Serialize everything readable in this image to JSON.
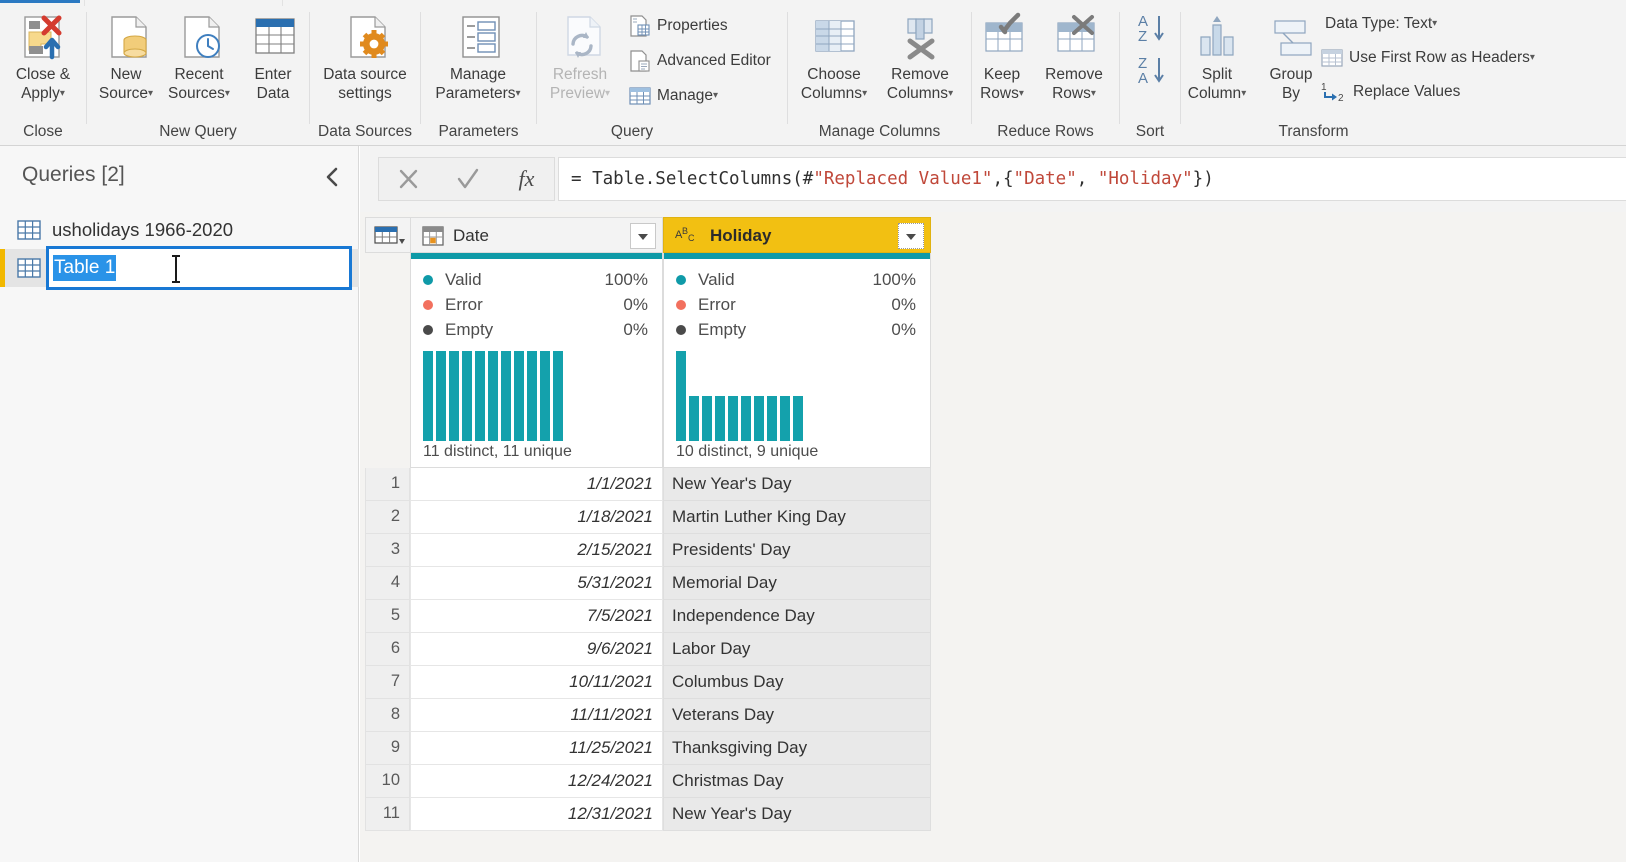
{
  "ribbon": {
    "groups": [
      {
        "name": "Close",
        "label": "Close",
        "buttons": [
          {
            "name": "close-and-apply",
            "line1": "Close &",
            "line2": "Apply",
            "dropdown": true,
            "disabled": false
          }
        ]
      },
      {
        "name": "New Query",
        "label": "New Query",
        "buttons": [
          {
            "name": "new-source",
            "line1": "New",
            "line2": "Source",
            "dropdown": true,
            "disabled": false
          },
          {
            "name": "recent-sources",
            "line1": "Recent",
            "line2": "Sources",
            "dropdown": true,
            "disabled": false
          },
          {
            "name": "enter-data",
            "line1": "Enter",
            "line2": "Data",
            "dropdown": false,
            "disabled": false
          }
        ]
      },
      {
        "name": "Data Sources",
        "label": "Data Sources",
        "buttons": [
          {
            "name": "data-source-settings",
            "line1": "Data source",
            "line2": "settings",
            "dropdown": false,
            "disabled": false
          }
        ]
      },
      {
        "name": "Parameters",
        "label": "Parameters",
        "buttons": [
          {
            "name": "manage-parameters",
            "line1": "Manage",
            "line2": "Parameters",
            "dropdown": true,
            "disabled": false
          }
        ]
      },
      {
        "name": "Query",
        "label": "Query",
        "buttons": [
          {
            "name": "refresh-preview",
            "line1": "Refresh",
            "line2": "Preview",
            "dropdown": true,
            "disabled": true
          }
        ],
        "small_buttons": [
          {
            "name": "properties",
            "label": "Properties",
            "dropdown": false
          },
          {
            "name": "advanced-editor",
            "label": "Advanced Editor",
            "dropdown": false
          },
          {
            "name": "manage",
            "label": "Manage",
            "dropdown": true
          }
        ]
      },
      {
        "name": "Manage Columns",
        "label": "Manage Columns",
        "buttons": [
          {
            "name": "choose-columns",
            "line1": "Choose",
            "line2": "Columns",
            "dropdown": true,
            "disabled": false
          },
          {
            "name": "remove-columns",
            "line1": "Remove",
            "line2": "Columns",
            "dropdown": true,
            "disabled": false
          }
        ]
      },
      {
        "name": "Reduce Rows",
        "label": "Reduce Rows",
        "buttons": [
          {
            "name": "keep-rows",
            "line1": "Keep",
            "line2": "Rows",
            "dropdown": true,
            "disabled": false
          },
          {
            "name": "remove-rows",
            "line1": "Remove",
            "line2": "Rows",
            "dropdown": true,
            "disabled": false
          }
        ]
      },
      {
        "name": "Sort",
        "label": "Sort",
        "buttons": [
          {
            "name": "sort-ascending",
            "line1": "",
            "line2": "",
            "dropdown": false,
            "disabled": false
          },
          {
            "name": "sort-descending",
            "line1": "",
            "line2": "",
            "dropdown": false,
            "disabled": false
          }
        ]
      },
      {
        "name": "Transform",
        "label": "Transform",
        "buttons": [
          {
            "name": "split-column",
            "line1": "Split",
            "line2": "Column",
            "dropdown": true,
            "disabled": false
          },
          {
            "name": "group-by",
            "line1": "Group",
            "line2": "By",
            "dropdown": false,
            "disabled": false
          }
        ],
        "small_buttons": [
          {
            "name": "data-type",
            "label": "Data Type: Text",
            "dropdown": true
          },
          {
            "name": "use-first-row-as-headers",
            "label": "Use First Row as Headers",
            "dropdown": true
          },
          {
            "name": "replace-values",
            "label": "Replace Values",
            "dropdown": false
          }
        ]
      }
    ]
  },
  "queries_pane": {
    "title": "Queries [2]",
    "collapse_icon": "chevron-left-icon",
    "items": [
      {
        "name": "usholidays-1966-2020",
        "label": "usholidays 1966-2020",
        "selected": false,
        "editing": false
      },
      {
        "name": "table-1",
        "label": "Table 1",
        "selected": true,
        "editing": true
      }
    ],
    "rename_value": "Table 1"
  },
  "formula_bar": {
    "cancel_icon": "close-icon",
    "accept_icon": "check-icon",
    "fx_icon": "fx-icon",
    "formula_parts": [
      {
        "text": "= Table.SelectColumns(#",
        "string": false
      },
      {
        "text": "\"Replaced Value1\"",
        "string": true
      },
      {
        "text": ",{",
        "string": false
      },
      {
        "text": "\"Date\"",
        "string": true
      },
      {
        "text": ", ",
        "string": false
      },
      {
        "text": "\"Holiday\"",
        "string": true
      },
      {
        "text": "})",
        "string": false
      }
    ],
    "formula_plain": "= Table.SelectColumns(#\"Replaced Value1\",{\"Date\", \"Holiday\"})"
  },
  "grid": {
    "select_all_icon": "select-all-icon",
    "columns": [
      {
        "name": "date",
        "header": "Date",
        "type_icon": "calendar-icon",
        "selected": false,
        "profile": {
          "valid_label": "Valid",
          "valid_value": "100%",
          "error_label": "Error",
          "error_value": "0%",
          "empty_label": "Empty",
          "empty_value": "0%",
          "footer": "11 distinct, 11 unique",
          "histogram": [
            1,
            1,
            1,
            1,
            1,
            1,
            1,
            1,
            1,
            1,
            1
          ]
        }
      },
      {
        "name": "holiday",
        "header": "Holiday",
        "type_icon": "abc-text-icon",
        "selected": true,
        "profile": {
          "valid_label": "Valid",
          "valid_value": "100%",
          "error_label": "Error",
          "error_value": "0%",
          "empty_label": "Empty",
          "empty_value": "0%",
          "footer": "10 distinct, 9 unique",
          "histogram": [
            2,
            1,
            1,
            1,
            1,
            1,
            1,
            1,
            1,
            1
          ]
        }
      }
    ],
    "rows": [
      {
        "num": "1",
        "date": "1/1/2021",
        "holiday": "New Year's Day"
      },
      {
        "num": "2",
        "date": "1/18/2021",
        "holiday": "Martin Luther King Day"
      },
      {
        "num": "3",
        "date": "2/15/2021",
        "holiday": "Presidents' Day"
      },
      {
        "num": "4",
        "date": "5/31/2021",
        "holiday": "Memorial Day"
      },
      {
        "num": "5",
        "date": "7/5/2021",
        "holiday": "Independence Day"
      },
      {
        "num": "6",
        "date": "9/6/2021",
        "holiday": "Labor Day"
      },
      {
        "num": "7",
        "date": "10/11/2021",
        "holiday": "Columbus Day"
      },
      {
        "num": "8",
        "date": "11/11/2021",
        "holiday": "Veterans Day"
      },
      {
        "num": "9",
        "date": "11/25/2021",
        "holiday": "Thanksgiving Day"
      },
      {
        "num": "10",
        "date": "12/24/2021",
        "holiday": "Christmas Day"
      },
      {
        "num": "11",
        "date": "12/31/2021",
        "holiday": "New Year's Day"
      }
    ]
  },
  "colors": {
    "ribbon_bg": "#f3f3f3",
    "accent_blue": "#1878d4",
    "selection_blue": "#2a93e8",
    "selected_column_header": "#f2c012",
    "query_accent": "#f2b800",
    "profile_teal": "#14a1ac",
    "error_red": "#f2705e",
    "string_literal": "#c0483a"
  }
}
